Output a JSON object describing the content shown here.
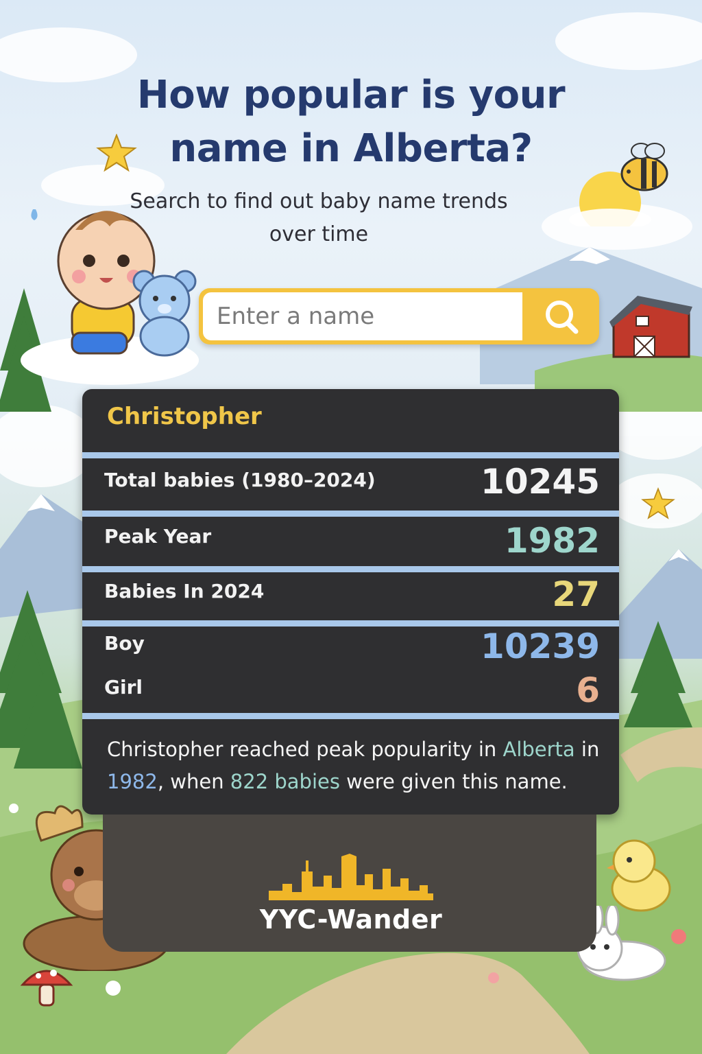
{
  "header": {
    "title_line1": "How popular is your",
    "title_line2": "name in Alberta?",
    "subtitle": "Search to find out baby name trends over time"
  },
  "search": {
    "placeholder": "Enter a name",
    "value": ""
  },
  "result": {
    "name": "Christopher",
    "total_label": "Total babies (1980–2024)",
    "total_value": "10245",
    "peak_label": "Peak Year",
    "peak_value": "1982",
    "recent_label": "Babies In 2024",
    "recent_value": "27",
    "boy_label": "Boy",
    "boy_value": "10239",
    "girl_label": "Girl",
    "girl_value": "6",
    "summary": {
      "part1": "Christopher reached peak popularity in ",
      "place": "Alberta",
      "part2": " in ",
      "year": "1982",
      "part3": ", when ",
      "count": "822 babies",
      "part4": " were given this name."
    }
  },
  "brand": "YYC-Wander",
  "colors": {
    "title": "#253a6e",
    "accent_yellow": "#f4c33f",
    "card_bg": "#2f2f31",
    "divider": "#a9c8ea",
    "name_gold": "#f0c649",
    "peak_teal": "#9ed6cc",
    "recent_yellow": "#e8d77a",
    "boy_blue": "#8eb8ea",
    "girl_peach": "#e8b08f"
  },
  "icons": [
    "search-icon",
    "baby-icon",
    "teddy-bear-icon",
    "bee-icon",
    "sun-icon",
    "star-icon",
    "barn-icon",
    "moose-icon",
    "chick-icon",
    "bunny-icon",
    "mushroom-icon",
    "skyline-icon"
  ]
}
